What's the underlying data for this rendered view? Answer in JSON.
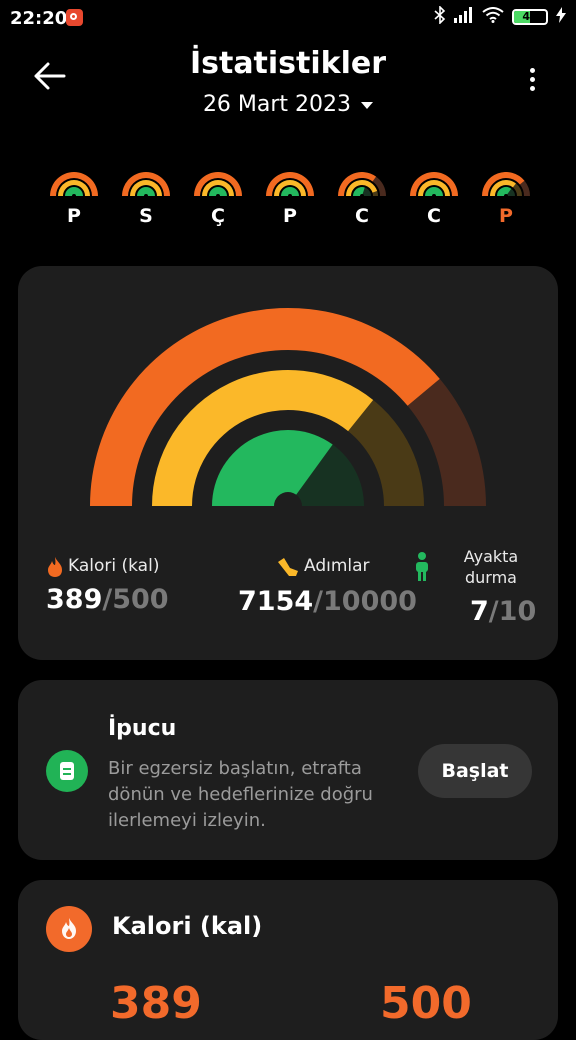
{
  "status_bar": {
    "time": "22:20",
    "battery": "49"
  },
  "header": {
    "title": "İstatistikler",
    "date": "26 Mart 2023"
  },
  "week": [
    {
      "label": "P",
      "move": 1,
      "steps": 1,
      "stand": 1,
      "active": false
    },
    {
      "label": "S",
      "move": 1,
      "steps": 1,
      "stand": 1,
      "active": false
    },
    {
      "label": "Ç",
      "move": 1,
      "steps": 1,
      "stand": 1,
      "active": false
    },
    {
      "label": "P",
      "move": 1,
      "steps": 1,
      "stand": 1,
      "active": false
    },
    {
      "label": "C",
      "move": 0.7,
      "steps": 0.9,
      "stand": 0.6,
      "active": false
    },
    {
      "label": "C",
      "move": 1,
      "steps": 1,
      "stand": 1,
      "active": false
    },
    {
      "label": "P",
      "move": 0.78,
      "steps": 0.715,
      "stand": 0.7,
      "active": true
    }
  ],
  "summary": {
    "calories": {
      "label": "Kalori (kal)",
      "value": "389",
      "goal": "/500",
      "progress": 0.778
    },
    "steps": {
      "label": "Adımlar",
      "value": "7154",
      "goal": "/10000",
      "progress": 0.7154
    },
    "stand": {
      "label": "Ayakta durma",
      "value": "7",
      "goal": "/10",
      "progress": 0.7
    }
  },
  "colors": {
    "calories": "#f26a21",
    "calories_bg": "#4a2a1e",
    "steps": "#fbb829",
    "steps_bg": "#4a3a16",
    "stand": "#23b85e",
    "stand_bg": "#173222"
  },
  "tip": {
    "title": "İpucu",
    "text": "Bir egzersiz başlatın, etrafta dönün ve hedeflerinize doğru ilerlemeyi izleyin.",
    "button": "Başlat",
    "icon": "note-icon"
  },
  "calorie_card": {
    "title": "Kalori (kal)",
    "current": "389",
    "goal": "500",
    "icon": "flame-icon"
  }
}
